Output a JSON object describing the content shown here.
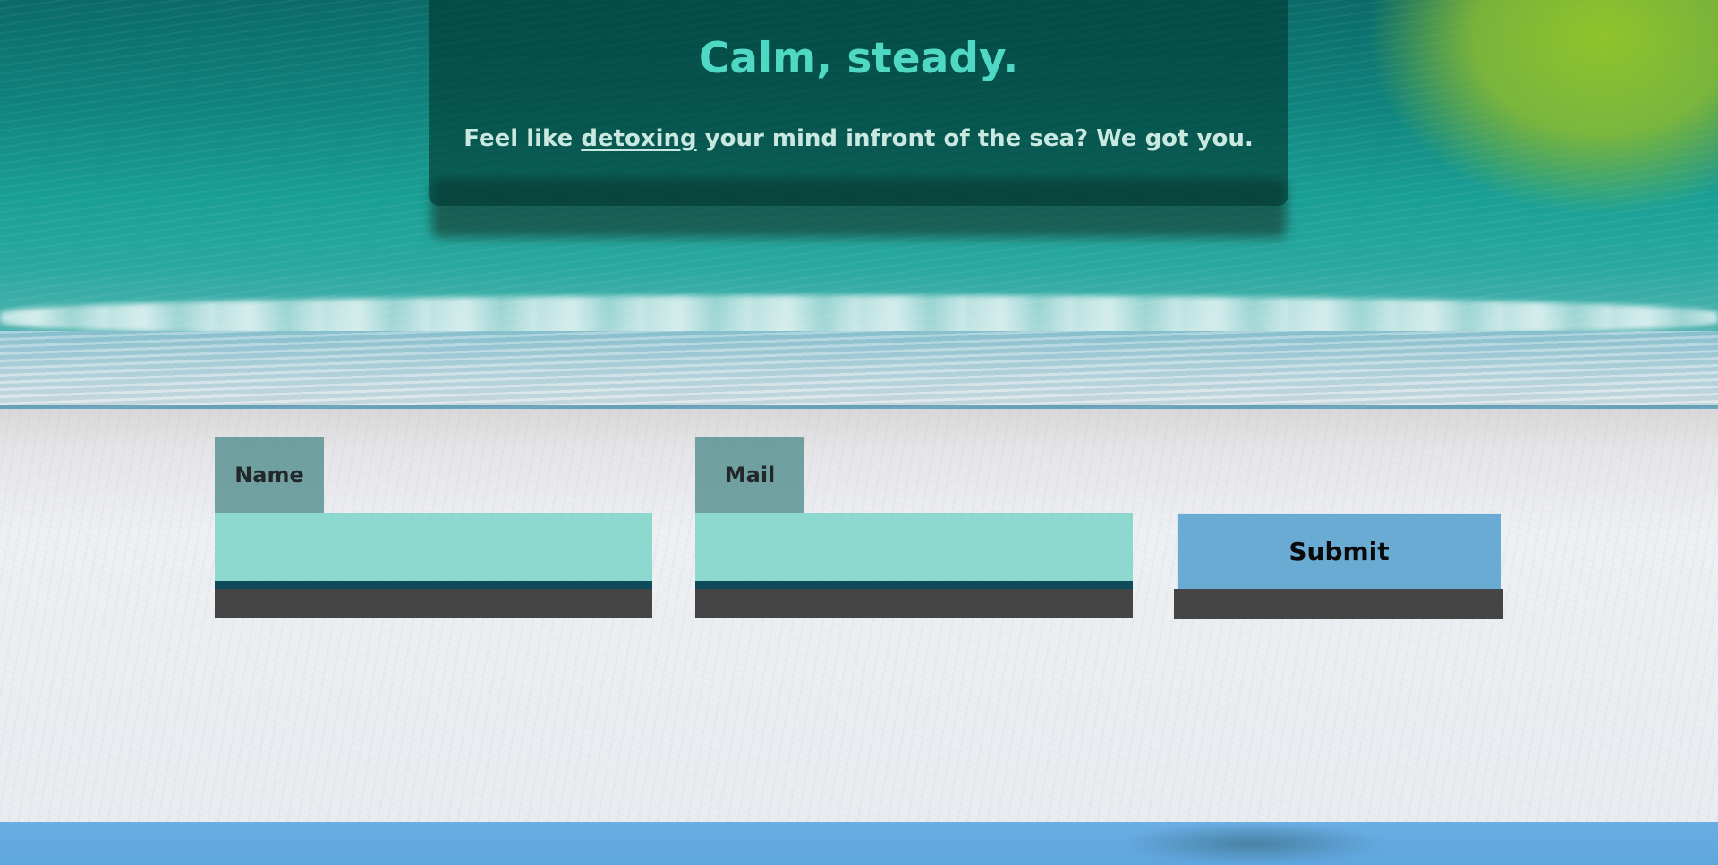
{
  "hero": {
    "title": "Calm, steady.",
    "subtitle_before": "Feel like ",
    "subtitle_link": "detoxing",
    "subtitle_after": " your mind infront of the sea? We got you."
  },
  "form": {
    "name_label": "Name",
    "name_value": "",
    "mail_label": "Mail",
    "mail_value": "",
    "submit_label": "Submit"
  },
  "colors": {
    "title": "#4fd9c4",
    "hero_box": "#00372f",
    "input_fill": "#6ed2c3",
    "input_underline": "#0e4a58",
    "label_fill": "#508c8c",
    "submit_fill": "#6aabd4",
    "shadow": "#454545",
    "footer": "#5ea6df"
  }
}
